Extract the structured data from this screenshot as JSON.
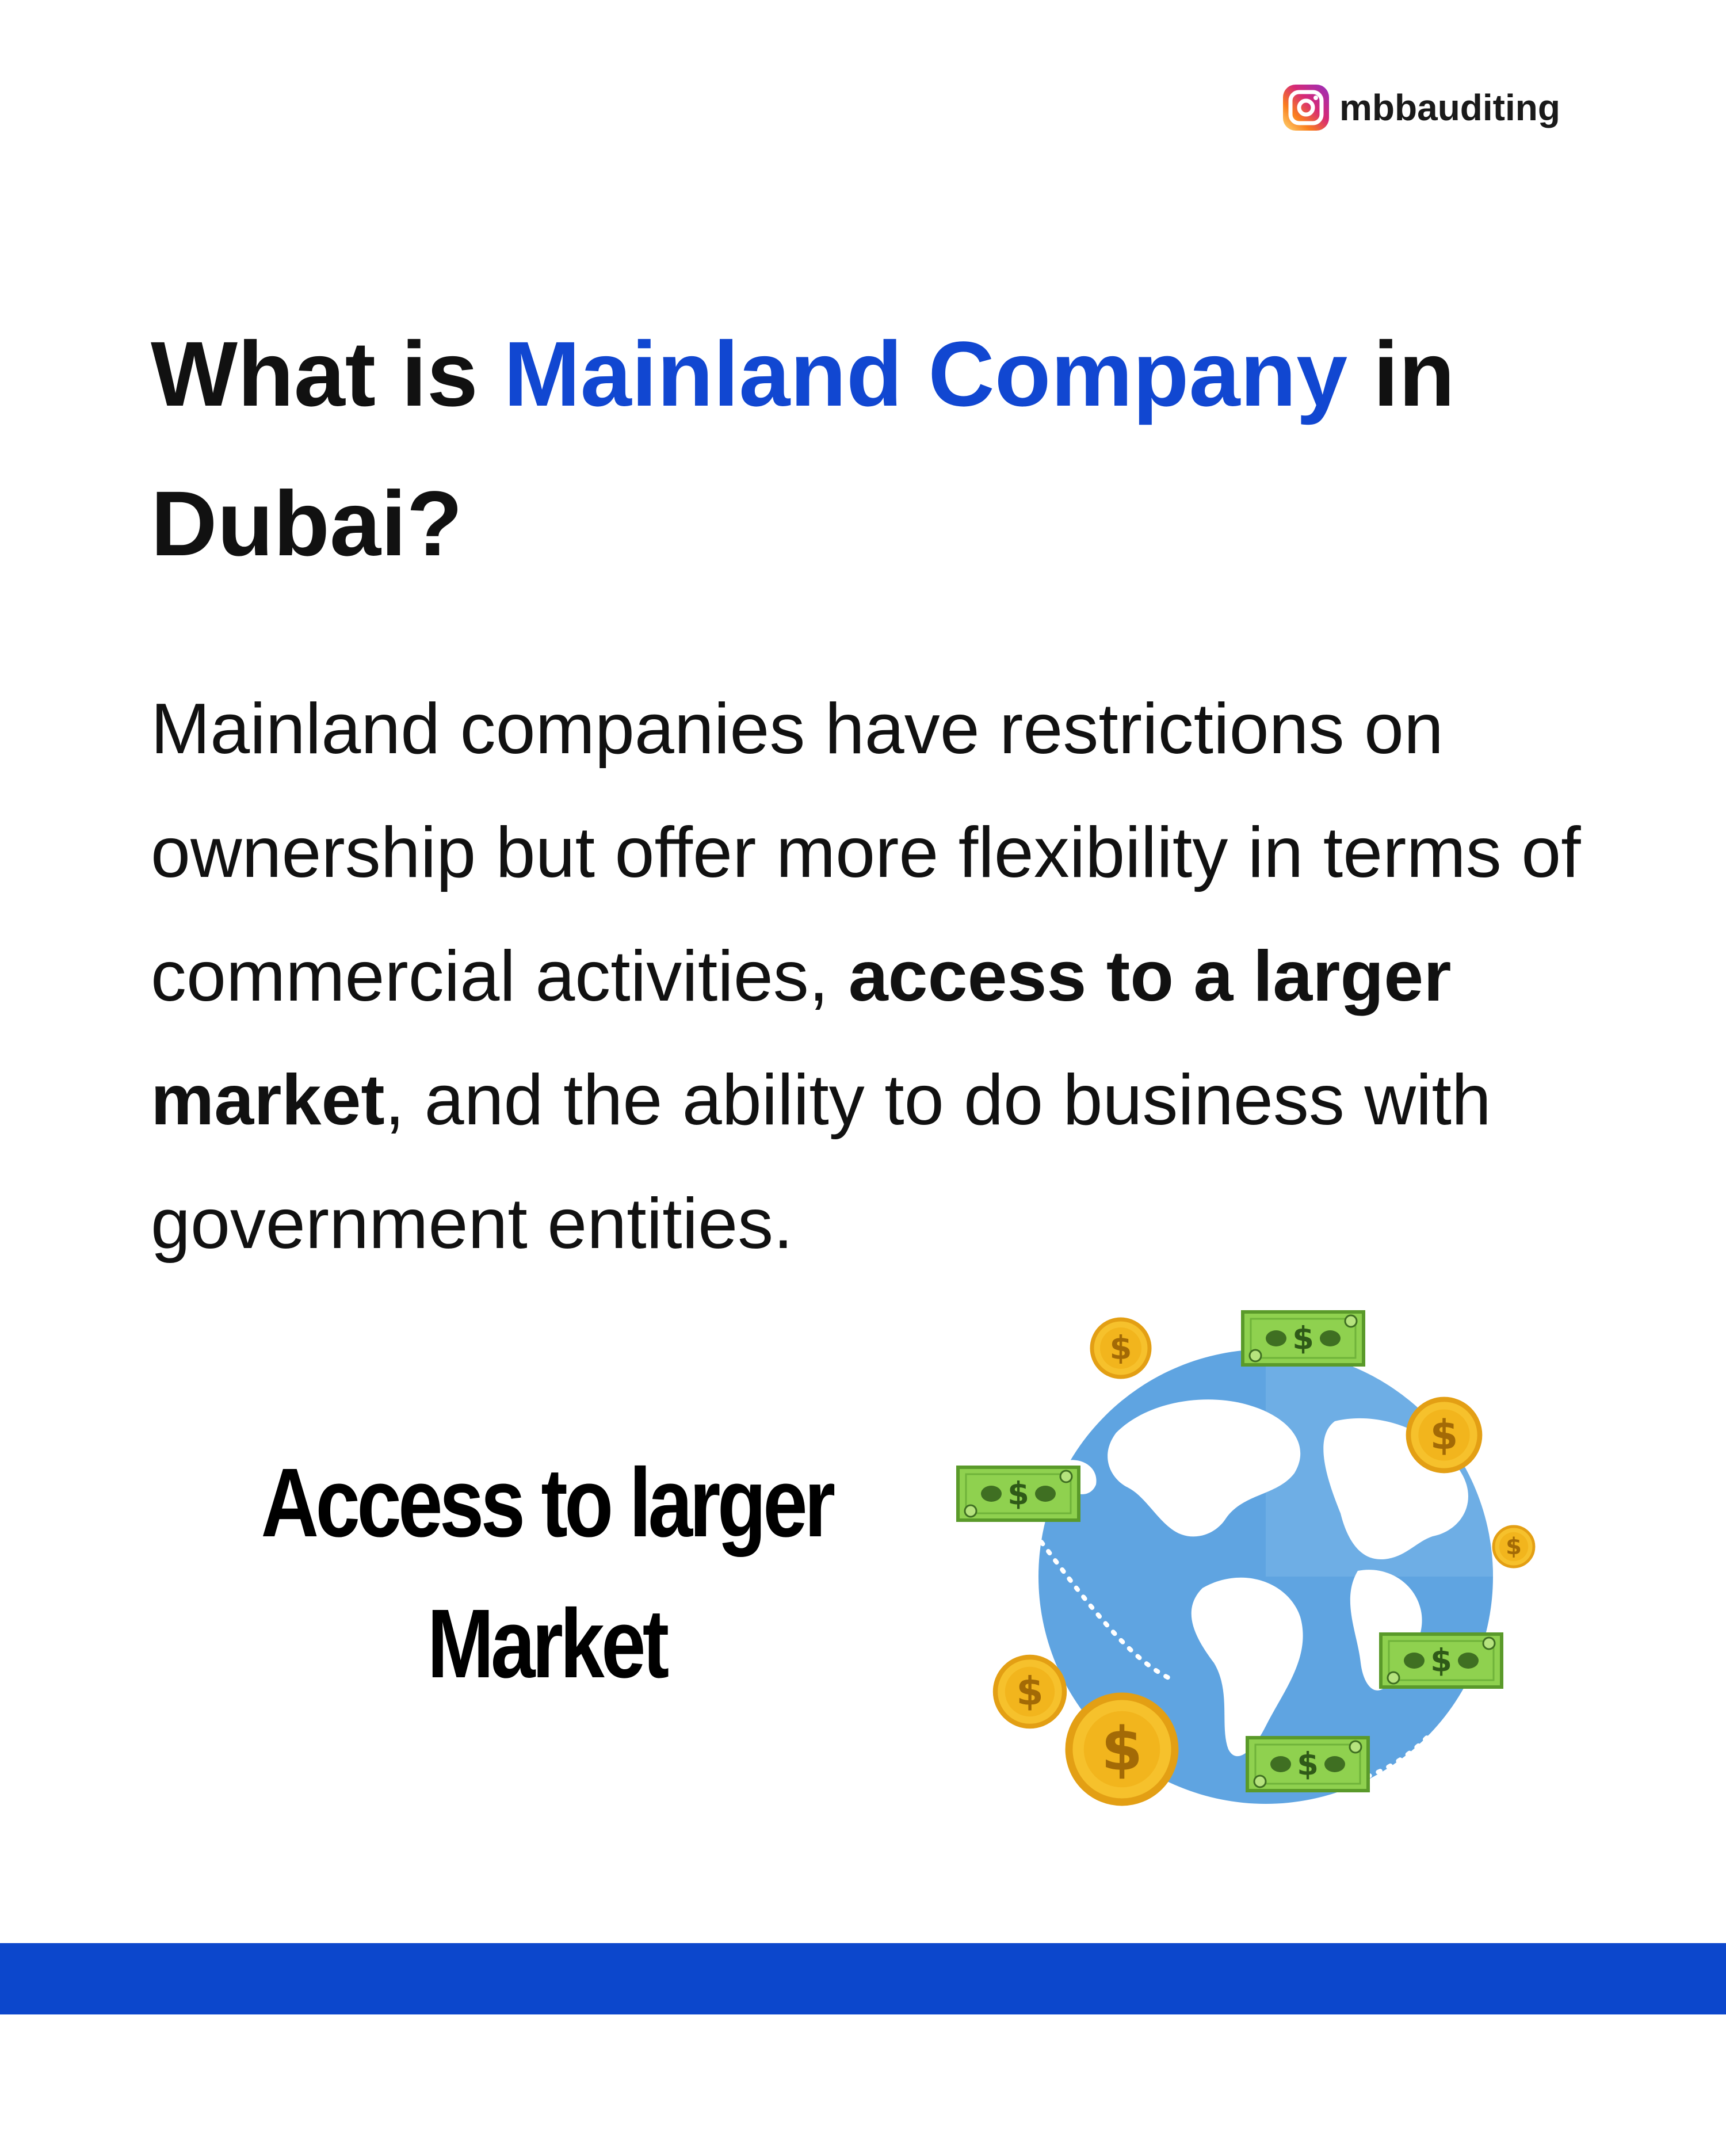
{
  "instagram": {
    "handle": "mbbauditing",
    "icon": "instagram-icon"
  },
  "headline": {
    "prefix": "What is ",
    "highlight": "Mainland Company",
    "suffix": " in Dubai?",
    "highlight_color": "#1147d1"
  },
  "body": {
    "part1": "Mainland companies have restrictions on ownership but offer more flexibility in terms of commercial activities, ",
    "bold": "access to a larger market",
    "part2": ", and the ability to do business with government entities."
  },
  "feature": {
    "caption_line1": "Access to larger",
    "caption_line2": "Market"
  },
  "illustration": {
    "icon": "globe-money-icon",
    "coin_symbol": "$"
  },
  "colors": {
    "accent": "#1147d1",
    "bottom_bar": "#0c47cc"
  }
}
